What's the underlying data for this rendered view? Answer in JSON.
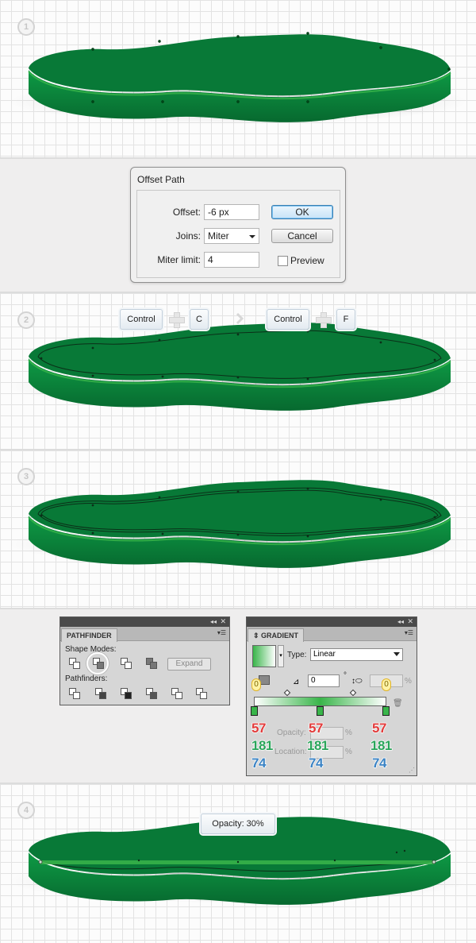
{
  "steps": [
    {
      "number": "1"
    },
    {
      "number": "2"
    },
    {
      "number": "3"
    },
    {
      "number": "4"
    }
  ],
  "colors": {
    "shape_top": "#087937",
    "shape_side": "#0a8a3e",
    "shape_side_dark": "#07692f",
    "rim_light": "#39b54a"
  },
  "offset_dialog": {
    "title": "Offset Path",
    "offset_label": "Offset:",
    "offset_value": "-6 px",
    "joins_label": "Joins:",
    "joins_value": "Miter",
    "miter_label": "Miter limit:",
    "miter_value": "4",
    "ok_label": "OK",
    "cancel_label": "Cancel",
    "preview_label": "Preview"
  },
  "shortcuts": {
    "key1": "Control",
    "key2": "C",
    "key3": "Control",
    "key4": "F"
  },
  "pathfinder": {
    "tab": "PATHFINDER",
    "shape_modes_label": "Shape Modes:",
    "pathfinders_label": "Pathfinders:",
    "expand_label": "Expand"
  },
  "gradient": {
    "tab": "GRADIENT",
    "type_label": "Type:",
    "type_value": "Linear",
    "angle_value": "0",
    "degree_symbol": "°",
    "percent": "%",
    "opacity_label": "Opacity:",
    "location_label": "Location:",
    "badge_left": "0",
    "badge_right": "0",
    "stops": [
      {
        "r": "57",
        "g": "181",
        "b": "74"
      },
      {
        "r": "57",
        "g": "181",
        "b": "74"
      },
      {
        "r": "57",
        "g": "181",
        "b": "74"
      }
    ]
  },
  "tooltip": {
    "text": "Opacity: 30%"
  }
}
